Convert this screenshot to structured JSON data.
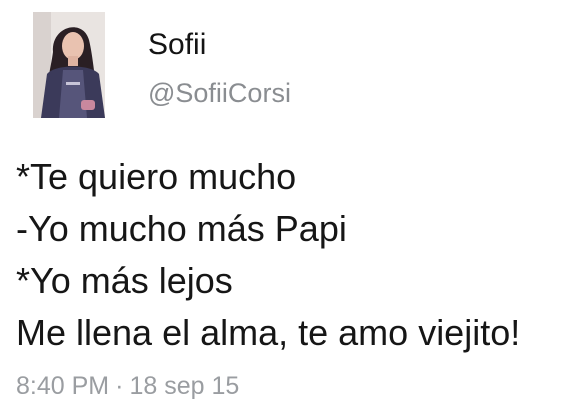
{
  "user": {
    "display_name": "Sofii",
    "handle": "@SofiiCorsi"
  },
  "tweet": {
    "lines": [
      "*Te quiero mucho",
      "-Yo mucho más Papi",
      "*Yo más lejos",
      "Me llena el alma, te amo viejito!"
    ],
    "time": "8:40 PM",
    "separator": "·",
    "date": "18 sep 15"
  }
}
